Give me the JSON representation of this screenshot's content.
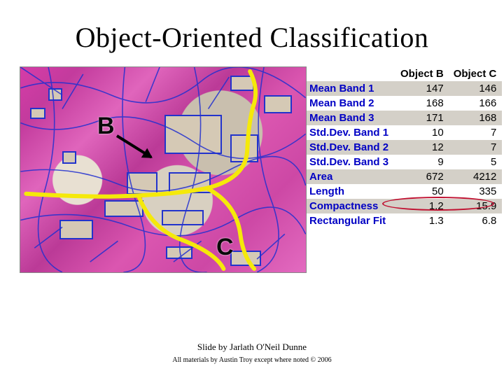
{
  "title": "Object-Oriented Classification",
  "markers": {
    "b": "B",
    "c": "C"
  },
  "footer": {
    "line1": "Slide by Jarlath O'Neil Dunne",
    "line2": "All materials by Austin Troy except where noted © 2006"
  },
  "chart_data": {
    "type": "table",
    "title": "Object feature statistics",
    "columns": [
      "",
      "Object B",
      "Object C"
    ],
    "rows": [
      {
        "label": "Mean Band 1",
        "b": 147,
        "c": 146,
        "band": true
      },
      {
        "label": "Mean Band 2",
        "b": 168,
        "c": 166,
        "band": false
      },
      {
        "label": "Mean Band 3",
        "b": 171,
        "c": 168,
        "band": true
      },
      {
        "label": "Std.Dev. Band 1",
        "b": 10,
        "c": 7,
        "band": false
      },
      {
        "label": "Std.Dev. Band 2",
        "b": 12,
        "c": 7,
        "band": true
      },
      {
        "label": "Std.Dev. Band 3",
        "b": 9,
        "c": 5,
        "band": false
      },
      {
        "label": "Area",
        "b": 672,
        "c": 4212,
        "band": true
      },
      {
        "label": "Length",
        "b": 50,
        "c": 335,
        "band": false
      },
      {
        "label": "Compactness",
        "b": 1.2,
        "c": 15.9,
        "band": true
      },
      {
        "label": "Rectangular Fit",
        "b": 1.3,
        "c": 6.8,
        "band": false
      }
    ]
  }
}
